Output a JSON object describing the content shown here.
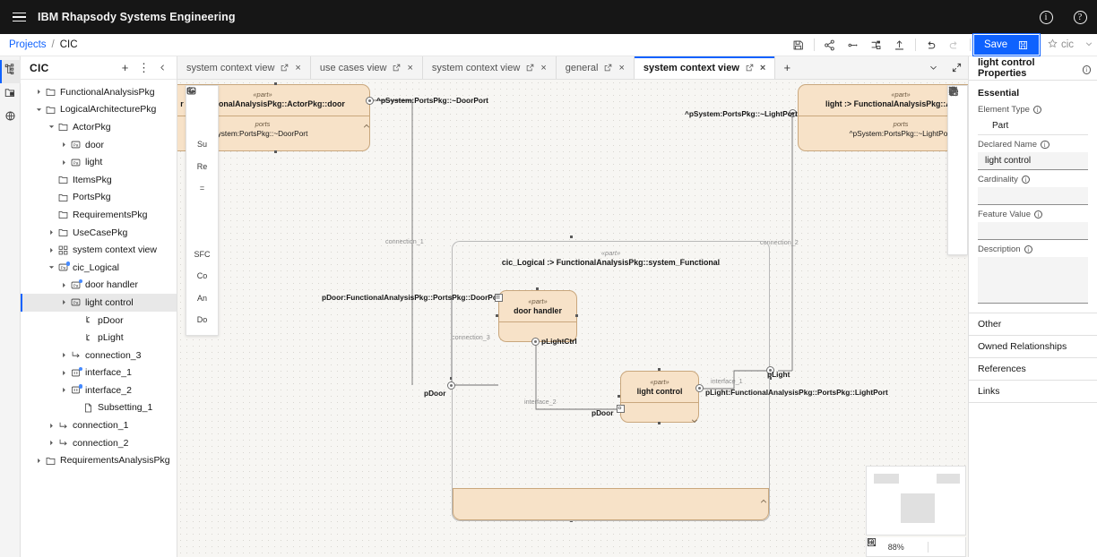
{
  "topbar": {
    "brand": "IBM Rhapsody Systems Engineering",
    "menu_icon": "hamburger-icon",
    "info_icon": "info-icon",
    "help_icon": "help-icon"
  },
  "breadcrumb": {
    "root": "Projects",
    "separator": "/",
    "current": "CIC"
  },
  "action_toolbar": {
    "items": [
      {
        "name": "save-diagram-icon",
        "label": "save-diagram"
      },
      {
        "name": "share-icon",
        "label": "share"
      },
      {
        "name": "link-icon",
        "label": "link"
      },
      {
        "name": "layout-icon",
        "label": "layout"
      },
      {
        "name": "export-icon",
        "label": "export"
      },
      {
        "name": "undo-icon",
        "label": "undo"
      },
      {
        "name": "redo-icon",
        "label": "redo"
      }
    ],
    "save_label": "Save",
    "save_icon": "save-floppy-icon",
    "favorite_icon": "star-icon",
    "favorite_label": "cic",
    "favorite_chevron": "chevron-down-icon"
  },
  "rail": {
    "items": [
      {
        "name": "sidebar-rail-model-explorer",
        "icon": "tree-hierarchy-icon",
        "active": true
      },
      {
        "name": "sidebar-rail-diagrams",
        "icon": "folder-copy-icon",
        "active": false
      },
      {
        "name": "sidebar-rail-settings",
        "icon": "globe-gear-icon",
        "active": false
      }
    ]
  },
  "tree": {
    "title": "CIC",
    "add_icon": "plus-icon",
    "overflow_icon": "overflow-menu-icon",
    "collapse_icon": "chevron-left-icon",
    "nodes": [
      {
        "label": "FunctionalAnalysisPkg",
        "indent": 1,
        "arrow": "right",
        "icon": "folder-icon",
        "badge": false,
        "selected": false
      },
      {
        "label": "LogicalArchitecturePkg",
        "indent": 1,
        "arrow": "down",
        "icon": "folder-icon",
        "badge": false,
        "selected": false
      },
      {
        "label": "ActorPkg",
        "indent": 2,
        "arrow": "down",
        "icon": "folder-icon",
        "badge": false,
        "selected": false
      },
      {
        "label": "door",
        "indent": 3,
        "arrow": "right",
        "icon": "part-icon",
        "badge": false,
        "selected": false
      },
      {
        "label": "light",
        "indent": 3,
        "arrow": "right",
        "icon": "part-icon",
        "badge": false,
        "selected": false
      },
      {
        "label": "ItemsPkg",
        "indent": 2,
        "arrow": "none",
        "icon": "folder-icon",
        "badge": false,
        "selected": false
      },
      {
        "label": "PortsPkg",
        "indent": 2,
        "arrow": "none",
        "icon": "folder-icon",
        "badge": false,
        "selected": false
      },
      {
        "label": "RequirementsPkg",
        "indent": 2,
        "arrow": "none",
        "icon": "folder-icon",
        "badge": false,
        "selected": false
      },
      {
        "label": "UseCasePkg",
        "indent": 2,
        "arrow": "right",
        "icon": "folder-icon",
        "badge": false,
        "selected": false
      },
      {
        "label": "system context view",
        "indent": 2,
        "arrow": "right",
        "icon": "diagram-icon",
        "badge": false,
        "selected": false
      },
      {
        "label": "cic_Logical",
        "indent": 2,
        "arrow": "down",
        "icon": "part-icon",
        "badge": true,
        "selected": false
      },
      {
        "label": "door handler",
        "indent": 3,
        "arrow": "right",
        "icon": "part-icon",
        "badge": true,
        "selected": false
      },
      {
        "label": "light control",
        "indent": 3,
        "arrow": "right",
        "icon": "part-icon",
        "badge": false,
        "selected": true
      },
      {
        "label": "pDoor",
        "indent": 4,
        "arrow": "none",
        "icon": "port-icon",
        "badge": false,
        "selected": false
      },
      {
        "label": "pLight",
        "indent": 4,
        "arrow": "none",
        "icon": "port-icon",
        "badge": false,
        "selected": false
      },
      {
        "label": "connection_3",
        "indent": 3,
        "arrow": "right",
        "icon": "connection-icon",
        "badge": false,
        "selected": false
      },
      {
        "label": "interface_1",
        "indent": 3,
        "arrow": "right",
        "icon": "interface-icon",
        "badge": true,
        "selected": false
      },
      {
        "label": "interface_2",
        "indent": 3,
        "arrow": "right",
        "icon": "interface-icon",
        "badge": true,
        "selected": false
      },
      {
        "label": "Subsetting_1",
        "indent": 4,
        "arrow": "none",
        "icon": "document-icon",
        "badge": false,
        "selected": false
      },
      {
        "label": "connection_1",
        "indent": 2,
        "arrow": "right",
        "icon": "connection-icon",
        "badge": false,
        "selected": false
      },
      {
        "label": "connection_2",
        "indent": 2,
        "arrow": "right",
        "icon": "connection-icon",
        "badge": false,
        "selected": false
      },
      {
        "label": "RequirementsAnalysisPkg",
        "indent": 1,
        "arrow": "right",
        "icon": "folder-icon",
        "badge": false,
        "selected": false
      }
    ]
  },
  "tabs": {
    "items": [
      {
        "label": "system context view",
        "active": false
      },
      {
        "label": "use cases view",
        "active": false
      },
      {
        "label": "system context view",
        "active": false
      },
      {
        "label": "general",
        "active": false
      },
      {
        "label": "system context view",
        "active": true
      }
    ],
    "popout_icon": "popout-icon",
    "close_icon": "close-icon",
    "add_tab_icon": "plus-icon",
    "overflow_icon": "chevron-down-icon",
    "expand_icon": "expand-icon"
  },
  "palette": {
    "items": [
      {
        "name": "palette-part",
        "label": "",
        "icon": "part-icon"
      },
      {
        "name": "palette-port",
        "label": "",
        "icon": "port-icon"
      },
      {
        "name": "palette-subsetting",
        "label": "Su",
        "icon": null
      },
      {
        "name": "palette-redefinition",
        "label": "Re",
        "icon": null
      },
      {
        "name": "palette-equal",
        "label": "=",
        "icon": null
      },
      {
        "name": "palette-connection",
        "label": "",
        "icon": "connection-icon"
      },
      {
        "name": "palette-interface",
        "label": "",
        "icon": "interface-icon"
      },
      {
        "name": "palette-sfc",
        "label": "SFC",
        "icon": null
      },
      {
        "name": "palette-comment",
        "label": "Co",
        "icon": null
      },
      {
        "name": "palette-annotation",
        "label": "An",
        "icon": null
      },
      {
        "name": "palette-documentation",
        "label": "Do",
        "icon": null
      }
    ]
  },
  "floating_toolbar": {
    "items": [
      {
        "name": "move-icon"
      },
      {
        "name": "select-area-icon"
      },
      {
        "name": "copy-icon"
      },
      {
        "name": "cut-scissors-icon"
      },
      {
        "name": "paste-icon"
      },
      {
        "name": "delete-trash-icon"
      },
      {
        "name": "settings-gear-icon"
      },
      {
        "name": "magic-wand-icon"
      }
    ]
  },
  "diagram": {
    "part_stereotype": "«part»",
    "ports_label": "ports",
    "blocks": {
      "door_actor": {
        "stereotype": "«part»",
        "name": "r :> FunctionalAnalysisPkg::ActorPkg::door",
        "ports_label": "ports",
        "port_name": "ystem:PortsPkg::~DoorPort"
      },
      "light_actor": {
        "stereotype": "«part»",
        "name": "light :> FunctionalAnalysisPkg::ActorPk",
        "ports_label": "ports",
        "port_name": "^pSystem:PortsPkg::~LightPort"
      },
      "system": {
        "stereotype": "«part»",
        "name": "cic_Logical :> FunctionalAnalysisPkg::system_Functional"
      },
      "door_handler": {
        "stereotype": "«part»",
        "name": "door handler"
      },
      "light_control": {
        "stereotype": "«part»",
        "name": "light control"
      }
    },
    "labels": {
      "door_port_ext": "^pSystem:PortsPkg::~DoorPort",
      "light_port_ext": "^pSystem:PortsPkg::~LightPort",
      "connection_1": "connection_1",
      "connection_2": "connection_2",
      "connection_3": "connection_3",
      "interface_1": "interface_1",
      "interface_2": "interface_2",
      "pdoor_full": "pDoor:FunctionalAnalysisPkg::PortsPkg::DoorPort",
      "plight_full": "pLight:FunctionalAnalysisPkg::PortsPkg::LightPort",
      "plightctrl": "pLightCtrl",
      "pdoor_sys": "pDoor",
      "pdoor_lc": "pDoor",
      "plight_sys": "pLight"
    }
  },
  "zoom_controls": {
    "minus_icon": "minus-icon",
    "level": "88%",
    "fit_icon": "zoom-fit-icon",
    "center_icon": "center-icon",
    "frame_icon": "frame-icon"
  },
  "properties": {
    "title": "light control Properties",
    "help_icon": "info-icon",
    "section": "Essential",
    "fields": [
      {
        "label": "Element Type",
        "value": "Part",
        "style": "plain"
      },
      {
        "label": "Declared Name",
        "value": "light control",
        "style": "filled"
      },
      {
        "label": "Cardinality",
        "value": "",
        "style": "filled"
      },
      {
        "label": "Feature Value",
        "value": "",
        "style": "filled"
      },
      {
        "label": "Description",
        "value": "",
        "style": "area"
      }
    ],
    "accordions": [
      "Other",
      "Owned Relationships",
      "References",
      "Links"
    ]
  },
  "colors": {
    "accent": "#0f62fe",
    "block_fill": "#f7e2c8",
    "block_border": "#c9a77d",
    "canvas": "#f7f6f3",
    "topbar": "#161616"
  }
}
